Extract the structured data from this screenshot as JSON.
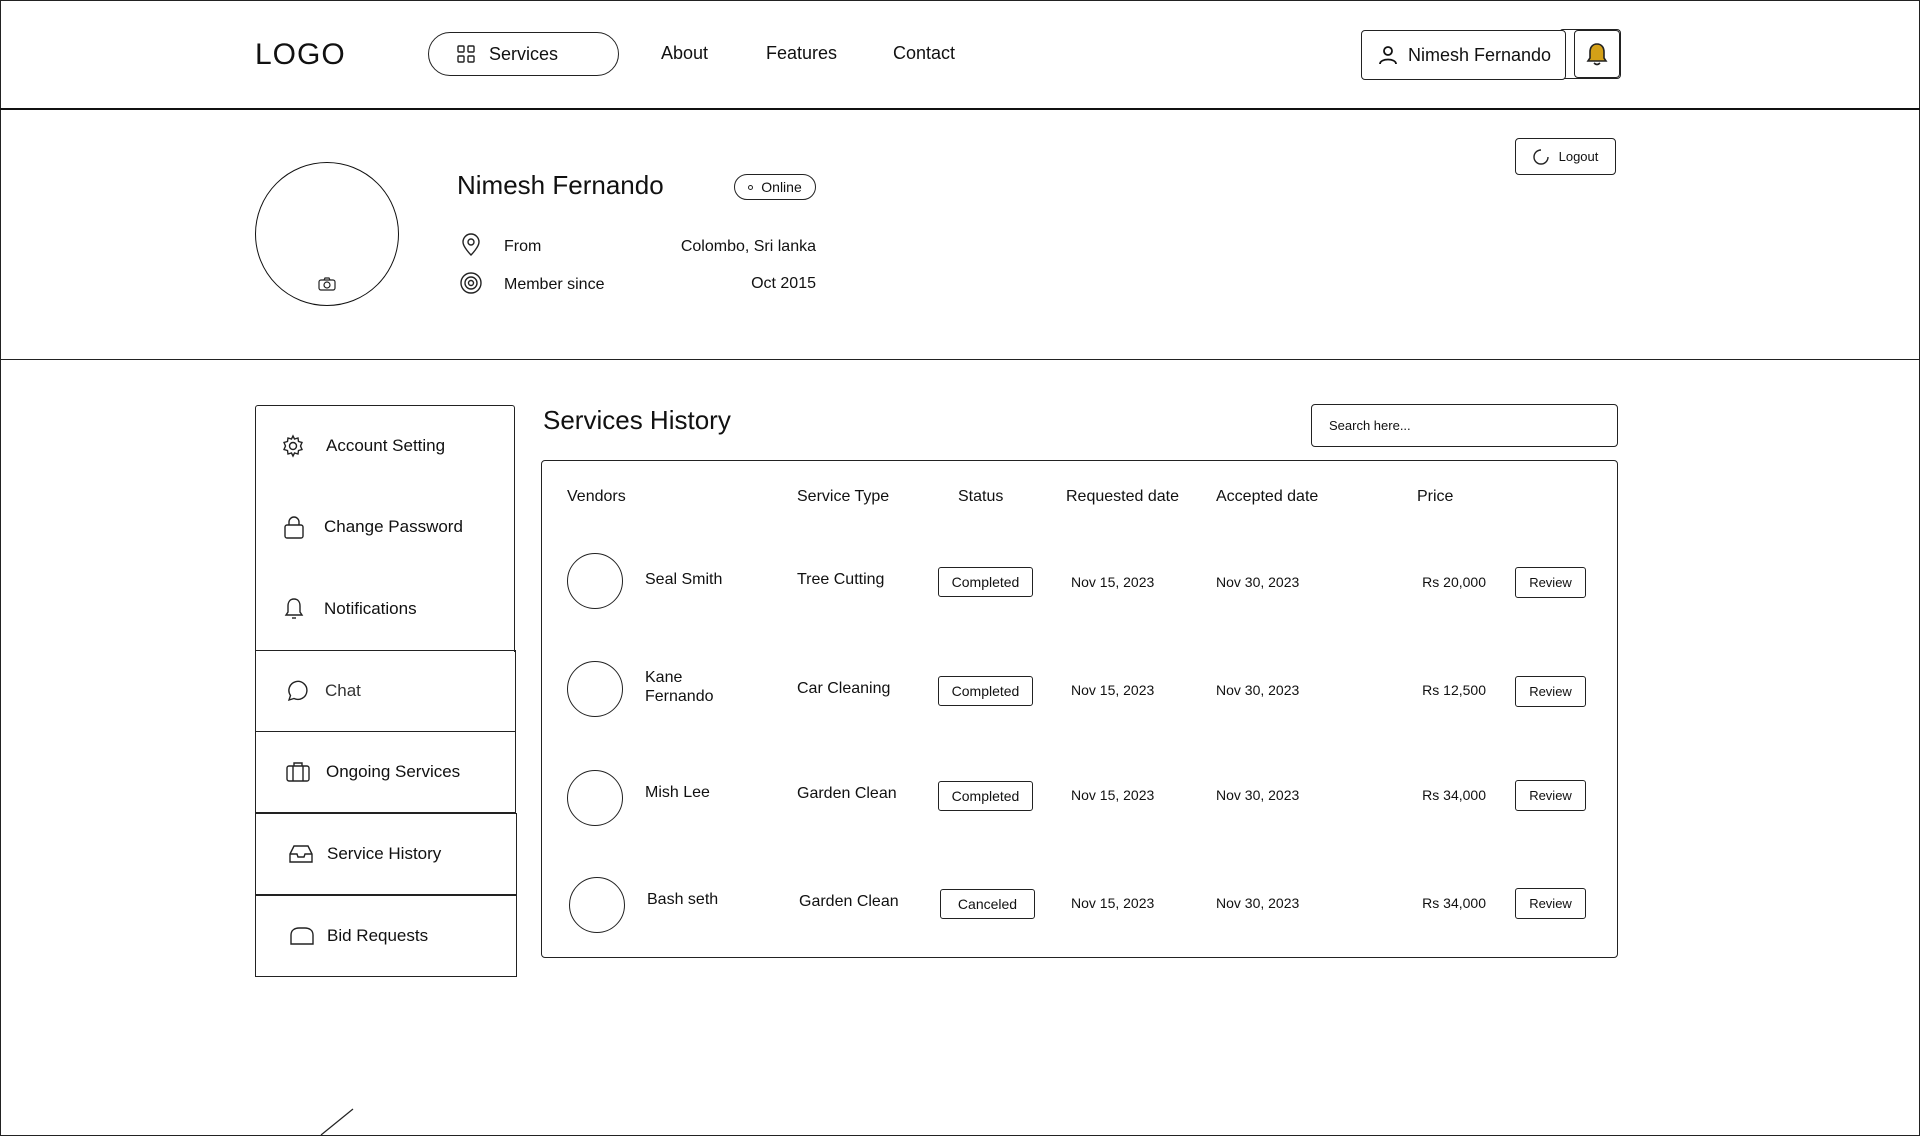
{
  "header": {
    "logo": "LOGO",
    "nav": {
      "services": "Services",
      "about": "About",
      "features": "Features",
      "contact": "Contact"
    },
    "user_name": "Nimesh Fernando",
    "bell_color": "#d4a017"
  },
  "profile": {
    "name": "Nimesh Fernando",
    "status": "Online",
    "from_label": "From",
    "from_value": "Colombo, Sri lanka",
    "member_label": "Member since",
    "member_value": "Oct 2015",
    "logout": "Logout"
  },
  "sidebar": {
    "items": [
      {
        "label": "Account Setting",
        "icon": "gear-icon"
      },
      {
        "label": "Change Password",
        "icon": "lock-icon"
      },
      {
        "label": "Notifications",
        "icon": "bell-icon"
      },
      {
        "label": "Chat",
        "icon": "chat-bubble-icon"
      },
      {
        "label": "Ongoing Services",
        "icon": "briefcase-icon"
      },
      {
        "label": "Service History",
        "icon": "inbox-icon"
      },
      {
        "label": "Bid Requests",
        "icon": "tag-icon"
      }
    ]
  },
  "main": {
    "title": "Services History",
    "search_placeholder": "Search here...",
    "columns": [
      "Vendors",
      "Service Type",
      "Status",
      "Requested date",
      "Accepted date",
      "Price"
    ],
    "rows": [
      {
        "vendor": "Seal Smith",
        "vendor_line2": "",
        "service": "Tree Cutting",
        "status": "Completed",
        "requested": "Nov  15, 2023",
        "accepted": "Nov 30, 2023",
        "price": "Rs 20,000",
        "action": "Review"
      },
      {
        "vendor": "Kane",
        "vendor_line2": "Fernando",
        "service": "Car Cleaning",
        "status": "Completed",
        "requested": "Nov  15, 2023",
        "accepted": "Nov 30, 2023",
        "price": "Rs 12,500",
        "action": "Review"
      },
      {
        "vendor": "Mish Lee",
        "vendor_line2": "",
        "service": "Garden Clean",
        "status": "Completed",
        "requested": "Nov  15, 2023",
        "accepted": "Nov 30, 2023",
        "price": "Rs 34,000",
        "action": "Review"
      },
      {
        "vendor": "Bash seth",
        "vendor_line2": "",
        "service": "Garden Clean",
        "status": "Canceled",
        "requested": "Nov  15, 2023",
        "accepted": "Nov 30, 2023",
        "price": "Rs 34,000",
        "action": "Review"
      }
    ]
  }
}
